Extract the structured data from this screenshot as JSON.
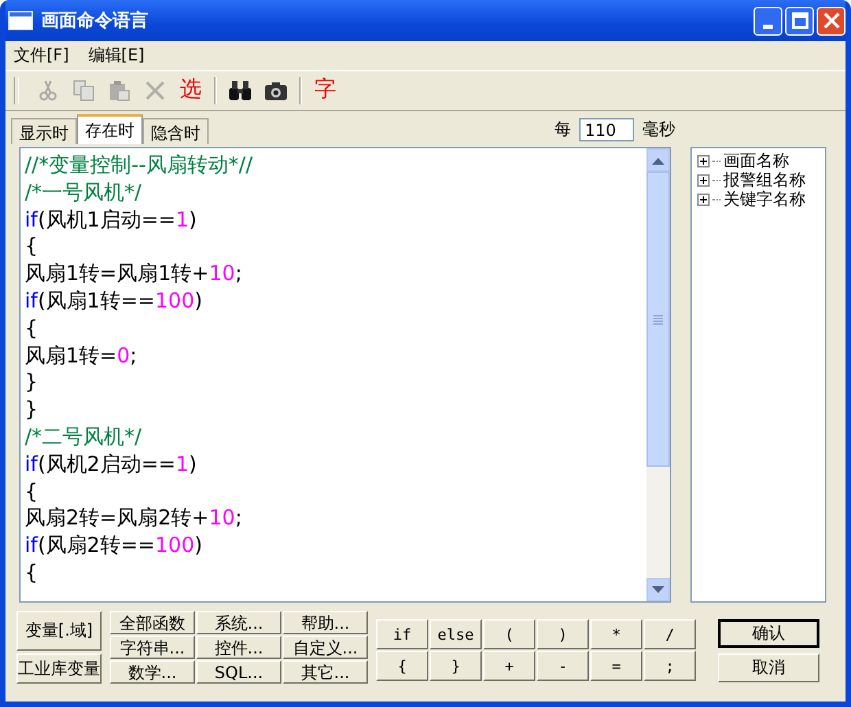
{
  "window": {
    "title": "画面命令语言"
  },
  "menu": [
    "文件[F]",
    "编辑[E]"
  ],
  "toolbar": [
    {
      "kind": "cut",
      "disabled": true
    },
    {
      "kind": "copy",
      "disabled": true
    },
    {
      "kind": "paste",
      "disabled": true
    },
    {
      "kind": "delete",
      "disabled": true
    },
    {
      "kind": "text",
      "label": "选",
      "disabled": false
    },
    {
      "kind": "sep"
    },
    {
      "kind": "find",
      "disabled": false
    },
    {
      "kind": "camera",
      "disabled": false
    },
    {
      "kind": "sep"
    },
    {
      "kind": "text",
      "label": "字",
      "disabled": false
    }
  ],
  "tabs": [
    {
      "label": "显示时",
      "selected": false
    },
    {
      "label": "存在时",
      "selected": true
    },
    {
      "label": "隐含时",
      "selected": false
    }
  ],
  "interval": {
    "prefix": "每",
    "value": "110",
    "unit": "毫秒"
  },
  "code_lines": [
    [
      {
        "kind": "comment",
        "text": "//*变量控制--风扇转动*//"
      }
    ],
    [
      {
        "kind": "comment",
        "text": "/*一号风机*/"
      }
    ],
    [
      {
        "kind": "keyword",
        "text": "if"
      },
      {
        "kind": "plain",
        "text": "(风机1启动=="
      },
      {
        "kind": "number",
        "text": "1"
      },
      {
        "kind": "plain",
        "text": ")"
      }
    ],
    [
      {
        "kind": "plain",
        "text": "{"
      }
    ],
    [
      {
        "kind": "plain",
        "text": "风扇1转=风扇1转+"
      },
      {
        "kind": "number",
        "text": "10"
      },
      {
        "kind": "plain",
        "text": ";"
      }
    ],
    [
      {
        "kind": "keyword",
        "text": "if"
      },
      {
        "kind": "plain",
        "text": "(风扇1转=="
      },
      {
        "kind": "number",
        "text": "100"
      },
      {
        "kind": "plain",
        "text": ")"
      }
    ],
    [
      {
        "kind": "plain",
        "text": "{"
      }
    ],
    [
      {
        "kind": "plain",
        "text": "风扇1转="
      },
      {
        "kind": "number",
        "text": "0"
      },
      {
        "kind": "plain",
        "text": ";"
      }
    ],
    [
      {
        "kind": "plain",
        "text": "}"
      }
    ],
    [
      {
        "kind": "plain",
        "text": "}"
      }
    ],
    [
      {
        "kind": "comment",
        "text": "/*二号风机*/"
      }
    ],
    [
      {
        "kind": "keyword",
        "text": "if"
      },
      {
        "kind": "plain",
        "text": "(风机2启动=="
      },
      {
        "kind": "number",
        "text": "1"
      },
      {
        "kind": "plain",
        "text": ")"
      }
    ],
    [
      {
        "kind": "plain",
        "text": "{"
      }
    ],
    [
      {
        "kind": "plain",
        "text": "风扇2转=风扇2转+"
      },
      {
        "kind": "number",
        "text": "10"
      },
      {
        "kind": "plain",
        "text": ";"
      }
    ],
    [
      {
        "kind": "keyword",
        "text": "if"
      },
      {
        "kind": "plain",
        "text": "(风扇2转=="
      },
      {
        "kind": "number",
        "text": "100"
      },
      {
        "kind": "plain",
        "text": ")"
      }
    ],
    [
      {
        "kind": "plain",
        "text": "{"
      }
    ]
  ],
  "tree": [
    {
      "label": "画面名称",
      "expanded": false
    },
    {
      "label": "报警组名称",
      "expanded": false
    },
    {
      "label": "关键字名称",
      "expanded": false
    }
  ],
  "variable_buttons": [
    "变量[.域]",
    "工业库变量"
  ],
  "function_buttons": [
    "全部函数",
    "系统...",
    "帮助...",
    "字符串...",
    "控件...",
    "自定义...",
    "数学...",
    "SQL...",
    "其它..."
  ],
  "operator_buttons": [
    "if",
    "else",
    "(",
    ")",
    "*",
    "/",
    "{",
    "}",
    "+",
    "-",
    "=",
    ";"
  ],
  "dialog_buttons": [
    {
      "label": "确认",
      "default": true
    },
    {
      "label": "取消",
      "default": false
    }
  ]
}
